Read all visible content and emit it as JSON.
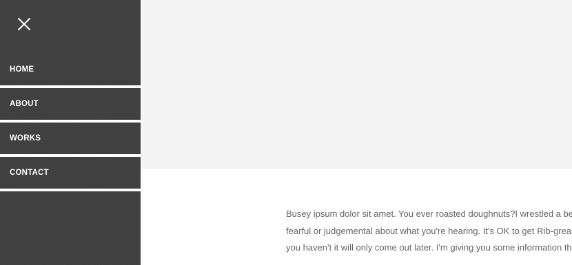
{
  "sidebar": {
    "close_icon": "close-icon",
    "nav_items": [
      {
        "label": "HOME"
      },
      {
        "label": "ABOUT"
      },
      {
        "label": "WORKS"
      },
      {
        "label": "CONTACT"
      }
    ]
  },
  "content": {
    "paragraph_lines": [
      "Busey ipsum dolor sit amet. You ever roasted doughnuts?I wrestled a bear once.",
      "fearful or judgemental about what you're hearing. It's OK to get Rib-grease on your",
      "you haven't it will only come out later. I'm giving you some information that you"
    ]
  },
  "colors": {
    "sidebar_bg": "#3f3f3f",
    "hero_bg": "#f4f4f4",
    "text": "#666666",
    "nav_text": "#ffffff"
  }
}
